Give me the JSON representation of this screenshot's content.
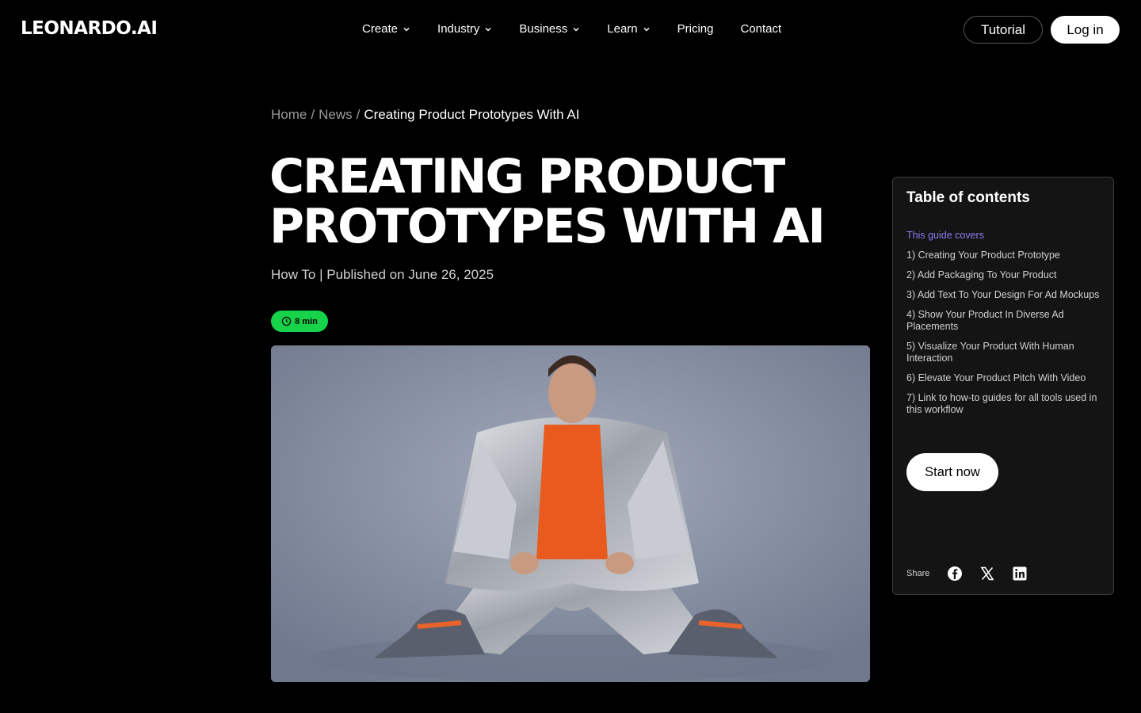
{
  "header": {
    "logo": "LEONARDO.AI",
    "nav": [
      {
        "label": "Create",
        "dropdown": true
      },
      {
        "label": "Industry",
        "dropdown": true
      },
      {
        "label": "Business",
        "dropdown": true
      },
      {
        "label": "Learn",
        "dropdown": true
      },
      {
        "label": "Pricing",
        "dropdown": false
      },
      {
        "label": "Contact",
        "dropdown": false
      }
    ],
    "tutorial_label": "Tutorial",
    "login_label": "Log in"
  },
  "breadcrumb": {
    "home": "Home",
    "news": "News",
    "separator": "/",
    "current": "Creating Product Prototypes With AI"
  },
  "article": {
    "title": "Creating Product Prototypes With AI",
    "meta": "How To | Published on June 26, 2025",
    "read_time": "8 min",
    "hero_image": "man in silver puffer jacket and orange shirt sitting on floor wearing sneakers"
  },
  "toc": {
    "title": "Table of contents",
    "items": [
      "This guide covers",
      "1) Creating Your Product Prototype",
      "2) Add Packaging To Your Product",
      "3) Add Text To Your Design For Ad Mockups",
      "4) Show Your Product In Diverse Ad Placements",
      "5) Visualize Your Product With Human Interaction",
      "6) Elevate Your Product Pitch With Video",
      "7) Link to how-to guides for all tools used in this workflow"
    ],
    "active_index": 0,
    "start_label": "Start now",
    "share_label": "Share",
    "share_icons": [
      "facebook-icon",
      "x-icon",
      "linkedin-icon"
    ]
  },
  "colors": {
    "background": "#000000",
    "badge": "#16d34a",
    "toc_active": "#8a7cf0",
    "toc_bg": "#141414"
  }
}
